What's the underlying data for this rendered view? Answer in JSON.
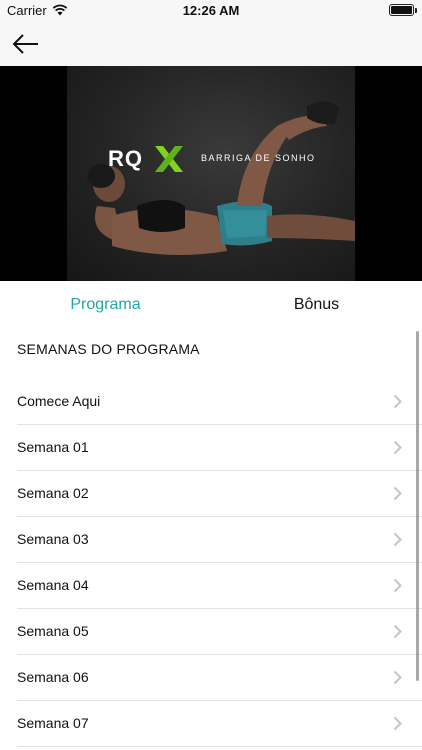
{
  "status_bar": {
    "carrier": "Carrier",
    "time": "12:26 AM",
    "battery_level": 1.0
  },
  "nav": {
    "back_icon": "arrow-left-icon"
  },
  "hero": {
    "logo_text": "RQ",
    "logo_mark_color": "#7fd321",
    "tagline": "BARRIGA DE SONHO"
  },
  "tabs": [
    {
      "label": "Programa",
      "selected": true
    },
    {
      "label": "Bônus",
      "selected": false
    }
  ],
  "section": {
    "title": "SEMANAS DO PROGRAMA"
  },
  "items": [
    {
      "label": "Comece Aqui"
    },
    {
      "label": "Semana 01"
    },
    {
      "label": "Semana 02"
    },
    {
      "label": "Semana 03"
    },
    {
      "label": "Semana 04"
    },
    {
      "label": "Semana 05"
    },
    {
      "label": "Semana 06"
    },
    {
      "label": "Semana 07"
    }
  ],
  "colors": {
    "accent": "#1fa8a1",
    "text": "#111111",
    "chevron": "#c4c4c9"
  }
}
